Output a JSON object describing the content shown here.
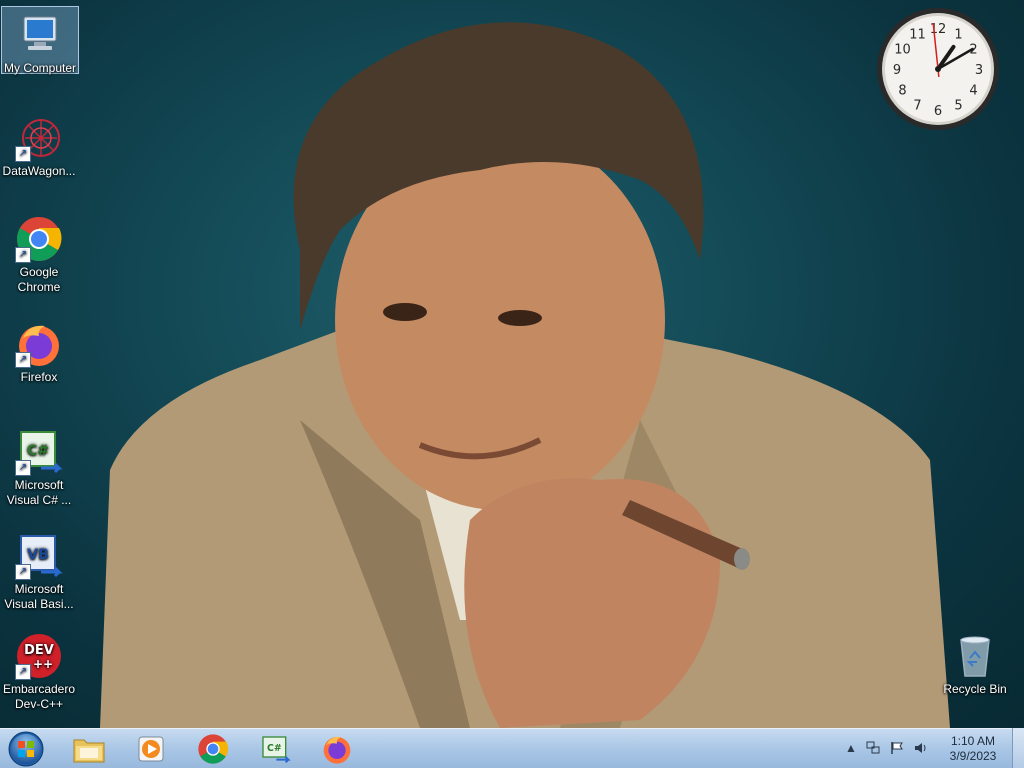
{
  "desktop_icons": [
    {
      "label": "My Computer",
      "icon": "computer-icon"
    },
    {
      "label": "DataWagon...",
      "icon": "datawagon-icon"
    },
    {
      "label": "Google Chrome",
      "icon": "chrome-icon"
    },
    {
      "label": "Firefox",
      "icon": "firefox-icon"
    },
    {
      "label": "Microsoft Visual C# ...",
      "icon": "csharp-icon"
    },
    {
      "label": "Microsoft Visual Basi...",
      "icon": "vb-icon"
    },
    {
      "label": "Embarcadero Dev-C++",
      "icon": "devcpp-icon"
    },
    {
      "label": "Recycle Bin",
      "icon": "recycle-bin-icon"
    }
  ],
  "clock": {
    "hour": 1,
    "minute": 10,
    "second": 59,
    "numerals": [
      "12",
      "1",
      "2",
      "3",
      "4",
      "5",
      "6",
      "7",
      "8",
      "9",
      "10",
      "11"
    ]
  },
  "icon_badges": {
    "csharp": "C#",
    "vb": "VB",
    "dev": "DEV",
    "plusplus": "++"
  },
  "taskbar": {
    "pinned": [
      {
        "name": "explorer",
        "icon": "folder-icon"
      },
      {
        "name": "media-player",
        "icon": "media-player-icon"
      },
      {
        "name": "chrome",
        "icon": "chrome-icon"
      },
      {
        "name": "visual-csharp",
        "icon": "csharp-icon"
      },
      {
        "name": "firefox",
        "icon": "firefox-icon"
      }
    ],
    "time": "1:10 AM",
    "date": "3/9/2023"
  },
  "colors": {
    "taskbar": "#a9c6e6",
    "desktop_bg": "#134a56",
    "selection": "#a0c8f0"
  }
}
